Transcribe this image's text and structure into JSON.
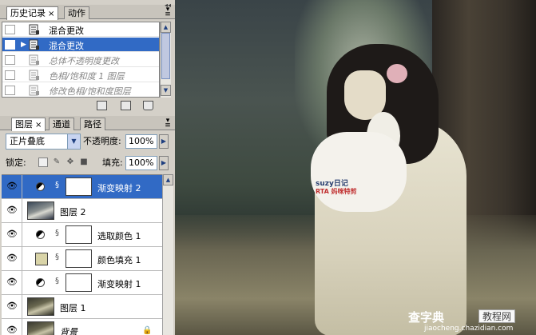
{
  "history_panel": {
    "tabs": [
      {
        "label": "历史记录",
        "close": "×"
      },
      {
        "label": "动作"
      }
    ],
    "items": [
      {
        "label": "混合更改",
        "state": "done"
      },
      {
        "label": "混合更改",
        "state": "current"
      },
      {
        "label": "总体不透明度更改",
        "state": "undone"
      },
      {
        "label": "色相/饱和度 1 图层",
        "state": "undone"
      },
      {
        "label": "修改色相/饱和度图层",
        "state": "undone"
      }
    ],
    "footer_icons": [
      "new-document-from-state-icon",
      "snapshot-icon",
      "trash-icon"
    ]
  },
  "layers_panel": {
    "tabs": [
      {
        "label": "图层",
        "close": "×"
      },
      {
        "label": "通道"
      },
      {
        "label": "路径"
      }
    ],
    "blend_mode": "正片叠底",
    "opacity_label": "不透明度:",
    "opacity_value": "100%",
    "lock_label": "锁定:",
    "fill_label": "填充:",
    "fill_value": "100%",
    "layers": [
      {
        "name": "渐变映射 2",
        "kind": "adjustment",
        "selected": true
      },
      {
        "name": "图层 2",
        "kind": "pixel"
      },
      {
        "name": "选取颜色 1",
        "kind": "adjustment"
      },
      {
        "name": "颜色填充 1",
        "kind": "fill",
        "color": "#d9d4a8"
      },
      {
        "name": "渐变映射 1",
        "kind": "adjustment"
      },
      {
        "name": "图层 1",
        "kind": "pixel"
      },
      {
        "name": "背景",
        "kind": "background",
        "locked": true
      }
    ]
  },
  "canvas": {
    "bunny_text": "suzy日记",
    "bunny_text2": "RTA 妈咪特剪",
    "watermark_main": "查字典",
    "watermark_box": "教程网",
    "watermark_url": "jiaocheng.chazidian.com"
  },
  "colors": {
    "selection": "#316ac5",
    "panel_bg": "#d4d0c8"
  }
}
